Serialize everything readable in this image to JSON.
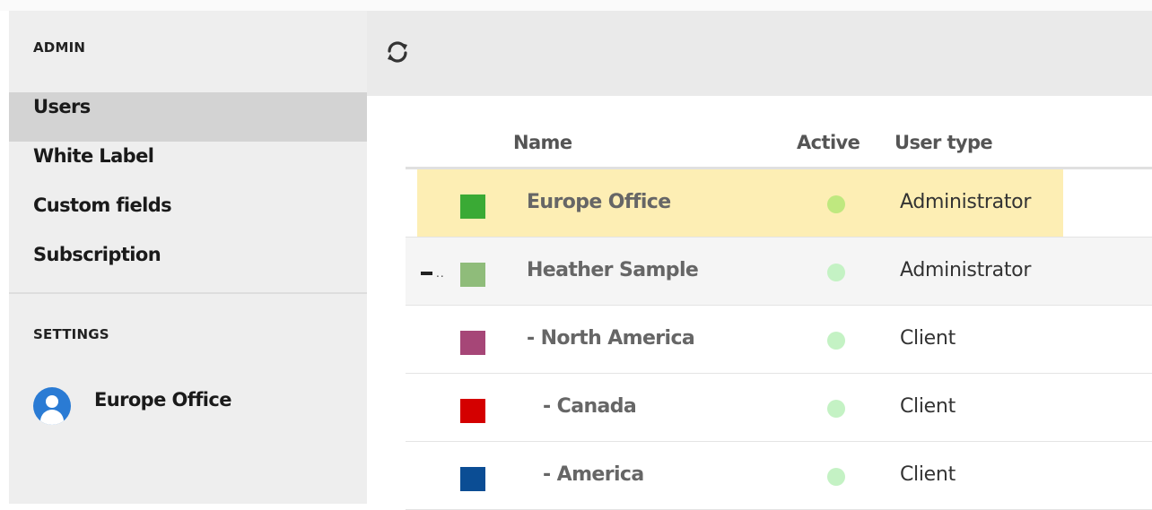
{
  "sidebar": {
    "admin_heading": "ADMIN",
    "items": [
      {
        "label": "Users",
        "active": true
      },
      {
        "label": "White Label",
        "active": false
      },
      {
        "label": "Custom fields",
        "active": false
      },
      {
        "label": "Subscription",
        "active": false
      }
    ],
    "settings_heading": "SETTINGS",
    "account": {
      "name": "Europe Office",
      "icon": "user-avatar-icon"
    }
  },
  "toolbar": {
    "refresh_icon": "refresh-icon"
  },
  "table": {
    "headers": {
      "name": "Name",
      "active": "Active",
      "user_type": "User type"
    },
    "rows": [
      {
        "name": "Europe Office",
        "color": "#3aaa35",
        "active": true,
        "active_color": "#bfe87f",
        "user_type": "Administrator",
        "highlighted": true
      },
      {
        "name": "Heather Sample",
        "color": "#8fbc7a",
        "active": true,
        "active_color": "#c4f2c4",
        "user_type": "Administrator",
        "collapse_icon": "collapse-icon"
      },
      {
        "name": "- North America",
        "color": "#a64677",
        "active": true,
        "active_color": "#c4f2c4",
        "user_type": "Client"
      },
      {
        "name": " - Canada",
        "color": "#d40000",
        "active": true,
        "active_color": "#c4f2c4",
        "user_type": "Client"
      },
      {
        "name": " - America",
        "color": "#0b4d94",
        "active": true,
        "active_color": "#c4f2c4",
        "user_type": "Client"
      }
    ]
  },
  "colors": {
    "highlight_row": "#fdeeb4",
    "sidebar_bg": "#eeeeee",
    "sidebar_active": "#d3d3d3",
    "avatar": "#2a7bd4"
  }
}
